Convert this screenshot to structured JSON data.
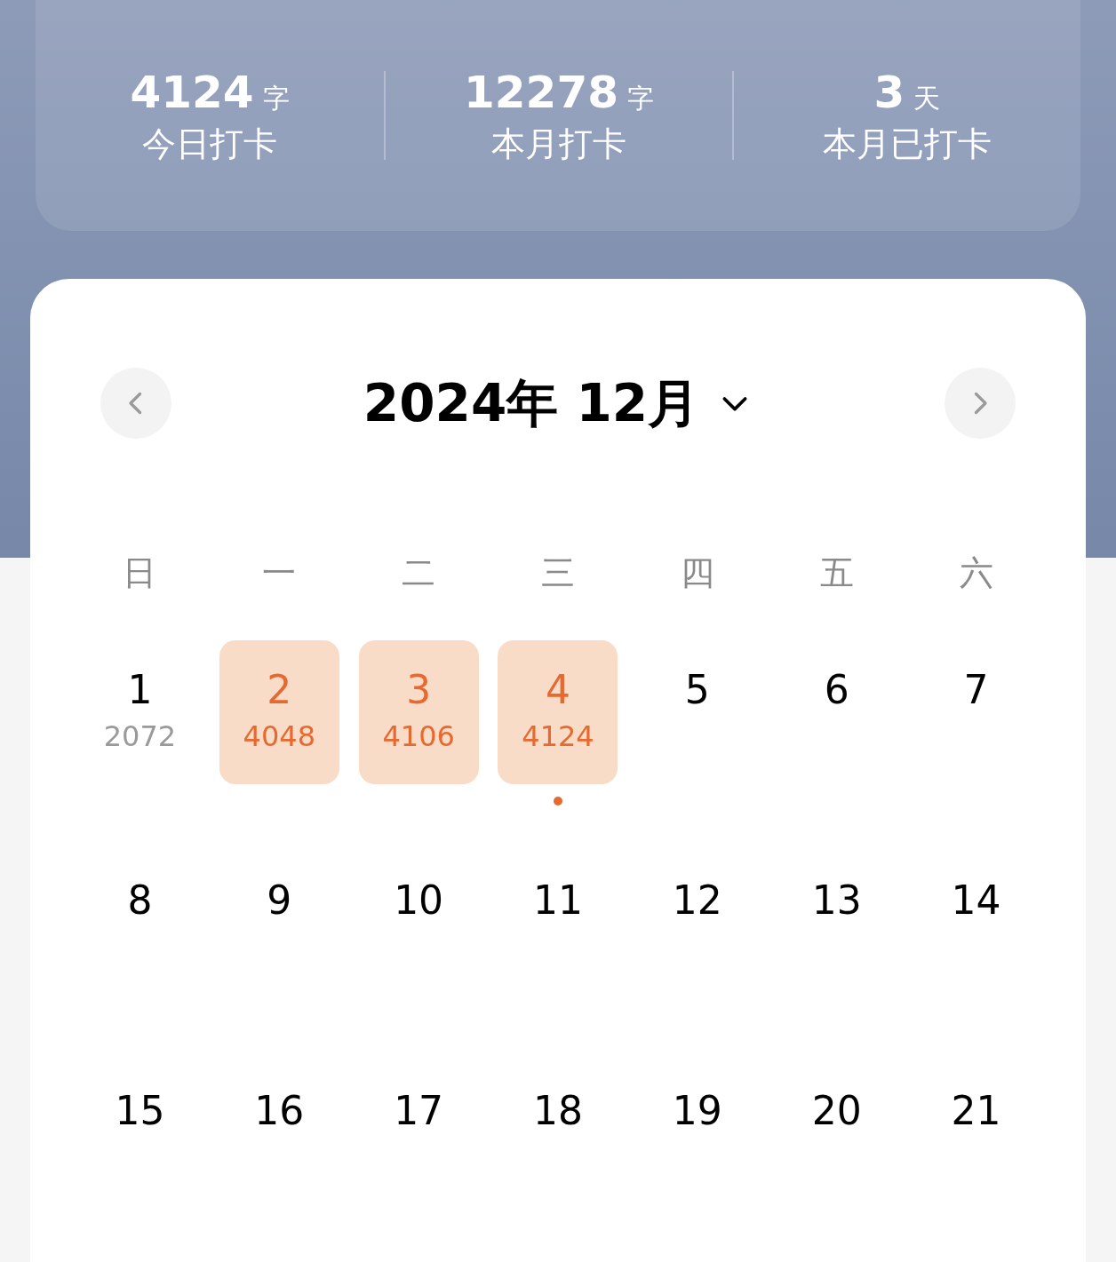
{
  "stats": [
    {
      "value": "4124",
      "unit": "字",
      "label": "今日打卡"
    },
    {
      "value": "12278",
      "unit": "字",
      "label": "本月打卡"
    },
    {
      "value": "3",
      "unit": "天",
      "label": "本月已打卡"
    }
  ],
  "calendar": {
    "title": "2024年 12月",
    "weekdays": [
      "日",
      "一",
      "二",
      "三",
      "四",
      "五",
      "六"
    ],
    "days": [
      {
        "day": "1",
        "count": "2072",
        "checked": false,
        "today": false
      },
      {
        "day": "2",
        "count": "4048",
        "checked": true,
        "today": false
      },
      {
        "day": "3",
        "count": "4106",
        "checked": true,
        "today": false
      },
      {
        "day": "4",
        "count": "4124",
        "checked": true,
        "today": true
      },
      {
        "day": "5",
        "checked": false,
        "today": false
      },
      {
        "day": "6",
        "checked": false,
        "today": false
      },
      {
        "day": "7",
        "checked": false,
        "today": false
      },
      {
        "day": "8",
        "checked": false,
        "today": false
      },
      {
        "day": "9",
        "checked": false,
        "today": false
      },
      {
        "day": "10",
        "checked": false,
        "today": false
      },
      {
        "day": "11",
        "checked": false,
        "today": false
      },
      {
        "day": "12",
        "checked": false,
        "today": false
      },
      {
        "day": "13",
        "checked": false,
        "today": false
      },
      {
        "day": "14",
        "checked": false,
        "today": false
      },
      {
        "day": "15",
        "checked": false,
        "today": false
      },
      {
        "day": "16",
        "checked": false,
        "today": false
      },
      {
        "day": "17",
        "checked": false,
        "today": false
      },
      {
        "day": "18",
        "checked": false,
        "today": false
      },
      {
        "day": "19",
        "checked": false,
        "today": false
      },
      {
        "day": "20",
        "checked": false,
        "today": false
      },
      {
        "day": "21",
        "checked": false,
        "today": false
      }
    ]
  }
}
